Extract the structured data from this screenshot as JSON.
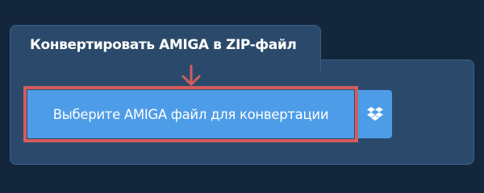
{
  "converter": {
    "title": "Конвертировать AMIGA в ZIP-файл",
    "select_button_label": "Выберите AMIGA файл для конвертации",
    "dropbox_icon": "dropbox-icon",
    "arrow_icon": "arrow-down-icon"
  },
  "colors": {
    "background": "#14263c",
    "panel": "#2b4a6b",
    "button": "#4d9ce8",
    "highlight": "#d35c5c"
  }
}
